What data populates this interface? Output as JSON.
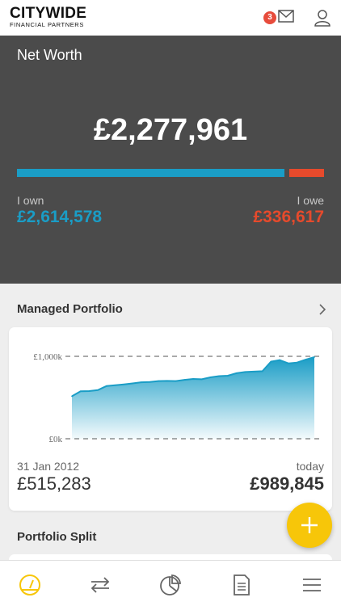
{
  "brand": {
    "name": "CITYWIDE",
    "tagline": "FINANCIAL PARTNERS"
  },
  "header": {
    "unread_count": "3",
    "mail_icon": "envelope-icon",
    "user_icon": "user-icon"
  },
  "net_worth": {
    "title": "Net Worth",
    "total": "£2,277,961",
    "own_label": "I own",
    "own_value": "£2,614,578",
    "owe_label": "I owe",
    "owe_value": "£336,617",
    "own_fraction": 0.886,
    "colors": {
      "own": "#1a9dc6",
      "owe": "#e64a2c"
    }
  },
  "managed_portfolio": {
    "title": "Managed Portfolio",
    "start_date": "31 Jan 2012",
    "start_value": "£515,283",
    "end_label": "today",
    "end_value": "£989,845"
  },
  "portfolio_split": {
    "title": "Portfolio Split"
  },
  "fab": {
    "icon": "plus-icon",
    "color": "#f7c609"
  },
  "nav": {
    "items": [
      "dashboard-gauge-icon",
      "transfer-arrows-icon",
      "pie-chart-icon",
      "document-icon",
      "menu-icon"
    ],
    "active_color": "#f7c609"
  },
  "chart_data": {
    "type": "area",
    "yticks": [
      "£1,000k",
      "£0k"
    ],
    "ylim": [
      0,
      1000000
    ],
    "color": "#1a9dc6",
    "values": [
      515283,
      575000,
      578000,
      590000,
      640000,
      650000,
      660000,
      672000,
      685000,
      688000,
      700000,
      702000,
      700000,
      715000,
      725000,
      722000,
      745000,
      760000,
      765000,
      795000,
      810000,
      815000,
      820000,
      935000,
      955000,
      915000,
      925000,
      960000,
      989845
    ]
  }
}
